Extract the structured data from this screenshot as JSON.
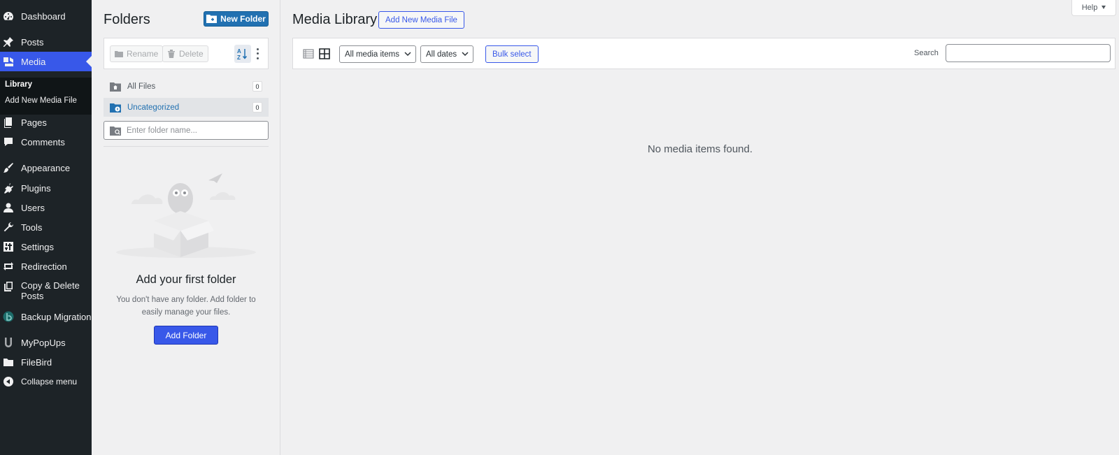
{
  "sidebar": {
    "items": [
      {
        "label": "Dashboard",
        "icon": "dashboard-icon"
      },
      {
        "label": "Posts",
        "icon": "pin-icon"
      },
      {
        "label": "Media",
        "icon": "media-icon"
      },
      {
        "label": "Pages",
        "icon": "pages-icon"
      },
      {
        "label": "Comments",
        "icon": "comment-icon"
      },
      {
        "label": "Appearance",
        "icon": "brush-icon"
      },
      {
        "label": "Plugins",
        "icon": "plugin-icon"
      },
      {
        "label": "Users",
        "icon": "user-icon"
      },
      {
        "label": "Tools",
        "icon": "wrench-icon"
      },
      {
        "label": "Settings",
        "icon": "settings-icon"
      },
      {
        "label": "Redirection",
        "icon": "redirect-icon"
      },
      {
        "label": "Copy & Delete Posts",
        "icon": "copy-icon"
      },
      {
        "label": "Backup Migration",
        "icon": "backup-icon"
      },
      {
        "label": "MyPopUps",
        "icon": "mypopups-icon"
      },
      {
        "label": "FileBird",
        "icon": "folder-icon"
      },
      {
        "label": "Collapse menu",
        "icon": "collapse-icon"
      }
    ],
    "submenu": [
      {
        "label": "Library"
      },
      {
        "label": "Add New Media File"
      }
    ],
    "accent": "#3858e9"
  },
  "folders": {
    "title": "Folders",
    "new_folder_label": "New Folder",
    "rename_label": "Rename",
    "delete_label": "Delete",
    "rows": [
      {
        "label": "All Files",
        "count": "0"
      },
      {
        "label": "Uncategorized",
        "count": "0"
      }
    ],
    "search_placeholder": "Enter folder name...",
    "empty_title": "Add your first folder",
    "empty_desc": "You don't have any folder. Add folder to easily manage your files.",
    "add_folder_label": "Add Folder"
  },
  "main": {
    "title": "Media Library",
    "add_new_label": "Add New Media File",
    "help_label": "Help",
    "filter_type": "All media items",
    "filter_date": "All dates",
    "bulk_select_label": "Bulk select",
    "search_label": "Search",
    "search_value": "",
    "empty_message": "No media items found."
  }
}
